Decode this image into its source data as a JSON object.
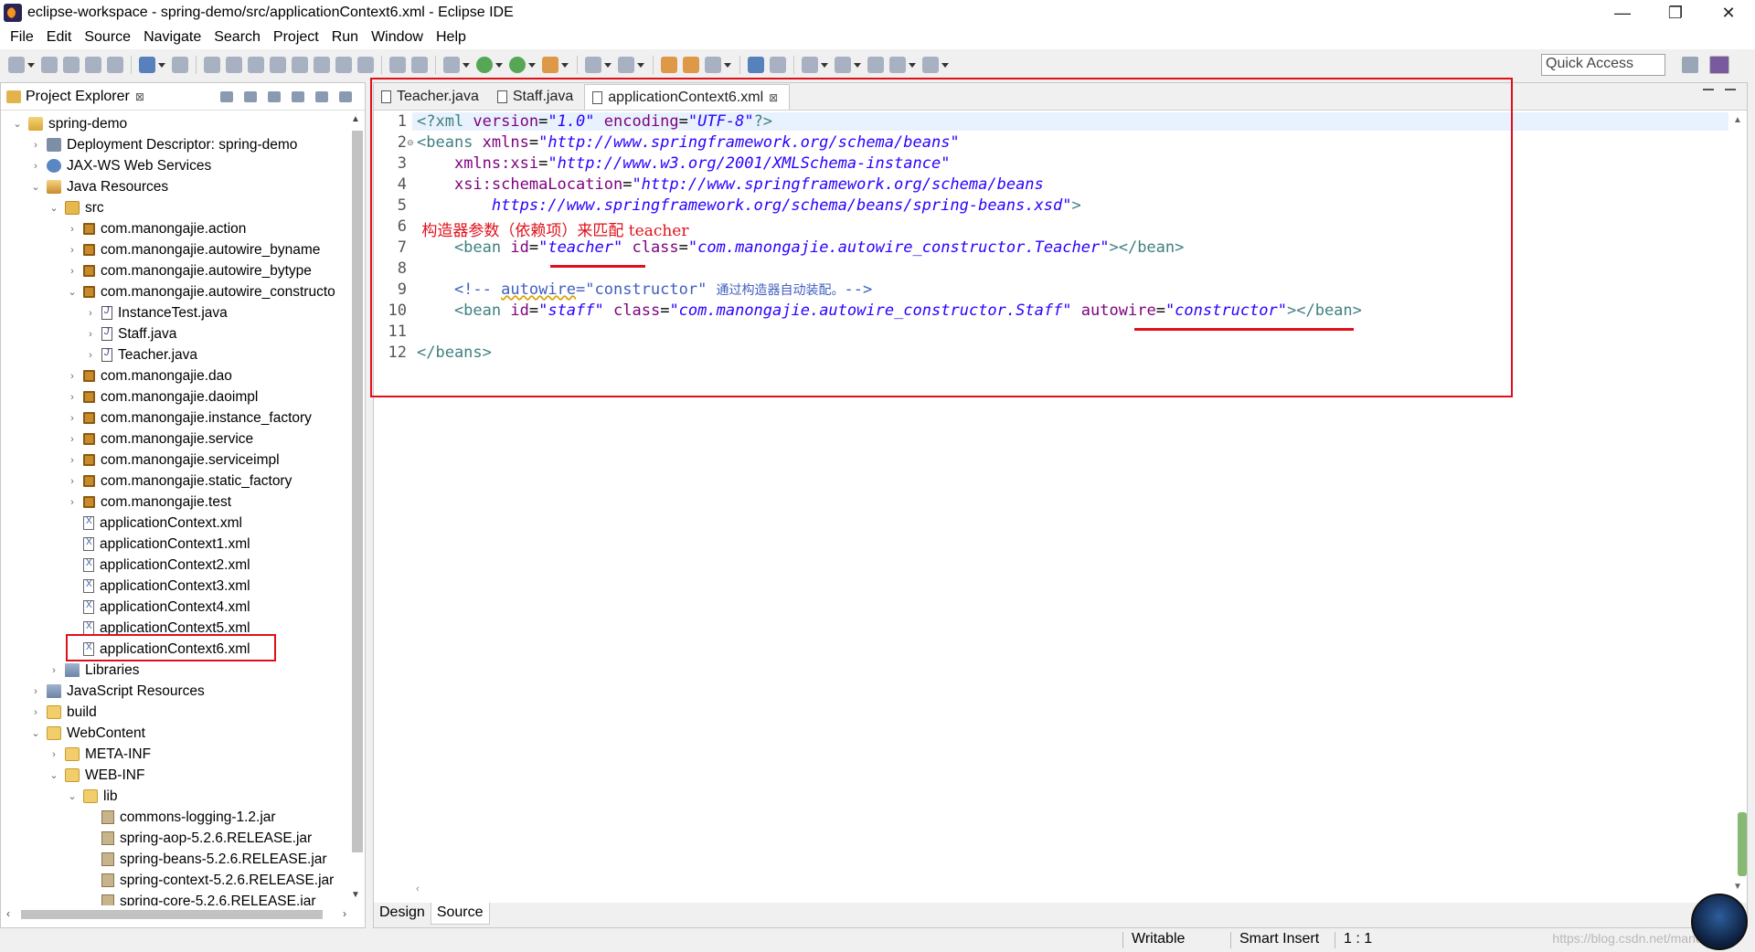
{
  "window": {
    "title": "eclipse-workspace - spring-demo/src/applicationContext6.xml - Eclipse IDE",
    "minimize": "—",
    "restore": "❐",
    "close": "✕"
  },
  "menu": [
    "File",
    "Edit",
    "Source",
    "Navigate",
    "Search",
    "Project",
    "Run",
    "Window",
    "Help"
  ],
  "toolbar": {
    "quick_access": "Quick Access"
  },
  "explorer": {
    "title": "Project Explorer",
    "close": "⊠",
    "tree": [
      {
        "label": "spring-demo",
        "indent": 0,
        "arrow": "⌄",
        "icon": "project"
      },
      {
        "label": "Deployment Descriptor: spring-demo",
        "indent": 1,
        "arrow": "›",
        "icon": "dd-ico"
      },
      {
        "label": "JAX-WS Web Services",
        "indent": 1,
        "arrow": "›",
        "icon": "ws"
      },
      {
        "label": "Java Resources",
        "indent": 1,
        "arrow": "⌄",
        "icon": "jr"
      },
      {
        "label": "src",
        "indent": 2,
        "arrow": "⌄",
        "icon": "src"
      },
      {
        "label": "com.manongajie.action",
        "indent": 3,
        "arrow": "›",
        "icon": "pkg"
      },
      {
        "label": "com.manongajie.autowire_byname",
        "indent": 3,
        "arrow": "›",
        "icon": "pkg"
      },
      {
        "label": "com.manongajie.autowire_bytype",
        "indent": 3,
        "arrow": "›",
        "icon": "pkg"
      },
      {
        "label": "com.manongajie.autowire_constructo",
        "indent": 3,
        "arrow": "⌄",
        "icon": "pkg"
      },
      {
        "label": "InstanceTest.java",
        "indent": 4,
        "arrow": "›",
        "icon": "java"
      },
      {
        "label": "Staff.java",
        "indent": 4,
        "arrow": "›",
        "icon": "java"
      },
      {
        "label": "Teacher.java",
        "indent": 4,
        "arrow": "›",
        "icon": "java"
      },
      {
        "label": "com.manongajie.dao",
        "indent": 3,
        "arrow": "›",
        "icon": "pkg"
      },
      {
        "label": "com.manongajie.daoimpl",
        "indent": 3,
        "arrow": "›",
        "icon": "pkg"
      },
      {
        "label": "com.manongajie.instance_factory",
        "indent": 3,
        "arrow": "›",
        "icon": "pkg"
      },
      {
        "label": "com.manongajie.service",
        "indent": 3,
        "arrow": "›",
        "icon": "pkg"
      },
      {
        "label": "com.manongajie.serviceimpl",
        "indent": 3,
        "arrow": "›",
        "icon": "pkg"
      },
      {
        "label": "com.manongajie.static_factory",
        "indent": 3,
        "arrow": "›",
        "icon": "pkg"
      },
      {
        "label": "com.manongajie.test",
        "indent": 3,
        "arrow": "›",
        "icon": "pkg"
      },
      {
        "label": "applicationContext.xml",
        "indent": 3,
        "arrow": "",
        "icon": "xml"
      },
      {
        "label": "applicationContext1.xml",
        "indent": 3,
        "arrow": "",
        "icon": "xml"
      },
      {
        "label": "applicationContext2.xml",
        "indent": 3,
        "arrow": "",
        "icon": "xml"
      },
      {
        "label": "applicationContext3.xml",
        "indent": 3,
        "arrow": "",
        "icon": "xml"
      },
      {
        "label": "applicationContext4.xml",
        "indent": 3,
        "arrow": "",
        "icon": "xml"
      },
      {
        "label": "applicationContext5.xml",
        "indent": 3,
        "arrow": "",
        "icon": "xml"
      },
      {
        "label": "applicationContext6.xml",
        "indent": 3,
        "arrow": "",
        "icon": "xml"
      },
      {
        "label": "Libraries",
        "indent": 2,
        "arrow": "›",
        "icon": "lib"
      },
      {
        "label": "JavaScript Resources",
        "indent": 1,
        "arrow": "›",
        "icon": "lib"
      },
      {
        "label": "build",
        "indent": 1,
        "arrow": "›",
        "icon": "folder"
      },
      {
        "label": "WebContent",
        "indent": 1,
        "arrow": "⌄",
        "icon": "folder"
      },
      {
        "label": "META-INF",
        "indent": 2,
        "arrow": "›",
        "icon": "folder"
      },
      {
        "label": "WEB-INF",
        "indent": 2,
        "arrow": "⌄",
        "icon": "folder"
      },
      {
        "label": "lib",
        "indent": 3,
        "arrow": "⌄",
        "icon": "folder"
      },
      {
        "label": "commons-logging-1.2.jar",
        "indent": 4,
        "arrow": "",
        "icon": "jar"
      },
      {
        "label": "spring-aop-5.2.6.RELEASE.jar",
        "indent": 4,
        "arrow": "",
        "icon": "jar"
      },
      {
        "label": "spring-beans-5.2.6.RELEASE.jar",
        "indent": 4,
        "arrow": "",
        "icon": "jar"
      },
      {
        "label": "spring-context-5.2.6.RELEASE.jar",
        "indent": 4,
        "arrow": "",
        "icon": "jar"
      },
      {
        "label": "spring-core-5.2.6.RELEASE.jar",
        "indent": 4,
        "arrow": "",
        "icon": "jar"
      }
    ]
  },
  "editor": {
    "tabs": [
      {
        "label": "Teacher.java",
        "active": false
      },
      {
        "label": "Staff.java",
        "active": false
      },
      {
        "label": "applicationContext6.xml",
        "active": true,
        "close": "⊠"
      }
    ],
    "line_numbers": [
      "1",
      "2",
      "3",
      "4",
      "5",
      "6",
      "7",
      "8",
      "9",
      "10",
      "11",
      "12"
    ],
    "fold_marker": "⊖",
    "code": {
      "l1": [
        "<?xml ",
        "version",
        "=",
        "\"1.0\"",
        " ",
        "encoding",
        "=",
        "\"UTF-8\"",
        "?>"
      ],
      "l2": [
        "<beans ",
        "xmlns",
        "=",
        "\"http://www.springframework.org/schema/beans\""
      ],
      "l3": [
        "    ",
        "xmlns:xsi",
        "=",
        "\"http://www.w3.org/2001/XMLSchema-instance\""
      ],
      "l4": [
        "    ",
        "xsi:schemaLocation",
        "=",
        "\"http://www.springframework.org/schema/beans"
      ],
      "l5": [
        "        https://www.springframework.org/schema/beans/spring-beans.xsd\"",
        ">"
      ],
      "l6": " 构造器参数（依赖项）来匹配 teacher",
      "l7": [
        "    <bean ",
        "id",
        "=",
        "\"teacher\"",
        " ",
        "class",
        "=",
        "\"com.manongajie.autowire_constructor.Teacher\"",
        "></bean>"
      ],
      "l9": [
        "    <!-- ",
        "autowire",
        "=\"constructor\" ",
        "通过构造器自动装配。",
        "-->"
      ],
      "l10": [
        "    <bean ",
        "id",
        "=",
        "\"staff\"",
        " ",
        "class",
        "=",
        "\"com.manongajie.autowire_constructor.Staff\"",
        " ",
        "autowire",
        "=",
        "\"constructor\"",
        "></bean>"
      ],
      "l12": [
        "</beans>"
      ]
    },
    "bottom_tabs": [
      {
        "label": "Design",
        "active": false
      },
      {
        "label": "Source",
        "active": true
      }
    ]
  },
  "status": {
    "writable": "Writable",
    "insert_mode": "Smart Insert",
    "position": "1 : 1",
    "watermark": "https://blog.csdn.net/manongajie"
  }
}
